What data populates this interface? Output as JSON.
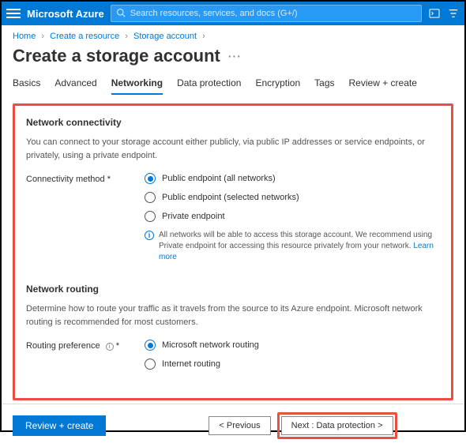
{
  "header": {
    "brand": "Microsoft Azure",
    "search_placeholder": "Search resources, services, and docs (G+/)"
  },
  "breadcrumb": {
    "items": [
      "Home",
      "Create a resource",
      "Storage account"
    ]
  },
  "page": {
    "title": "Create a storage account"
  },
  "tabs": {
    "items": [
      {
        "label": "Basics"
      },
      {
        "label": "Advanced"
      },
      {
        "label": "Networking"
      },
      {
        "label": "Data protection"
      },
      {
        "label": "Encryption"
      },
      {
        "label": "Tags"
      },
      {
        "label": "Review + create"
      }
    ],
    "active_index": 2
  },
  "network_connectivity": {
    "title": "Network connectivity",
    "description": "You can connect to your storage account either publicly, via public IP addresses or service endpoints, or privately, using a private endpoint.",
    "label": "Connectivity method *",
    "options": [
      "Public endpoint (all networks)",
      "Public endpoint (selected networks)",
      "Private endpoint"
    ],
    "selected_index": 0,
    "info_text": "All networks will be able to access this storage account. We recommend using Private endpoint for accessing this resource privately from your network. ",
    "info_link": "Learn more"
  },
  "network_routing": {
    "title": "Network routing",
    "description": "Determine how to route your traffic as it travels from the source to its Azure endpoint. Microsoft network routing is recommended for most customers.",
    "label": "Routing preference",
    "label_suffix": "*",
    "options": [
      "Microsoft network routing",
      "Internet routing"
    ],
    "selected_index": 0
  },
  "footer": {
    "review_create": "Review + create",
    "previous": "< Previous",
    "next": "Next : Data protection >"
  }
}
